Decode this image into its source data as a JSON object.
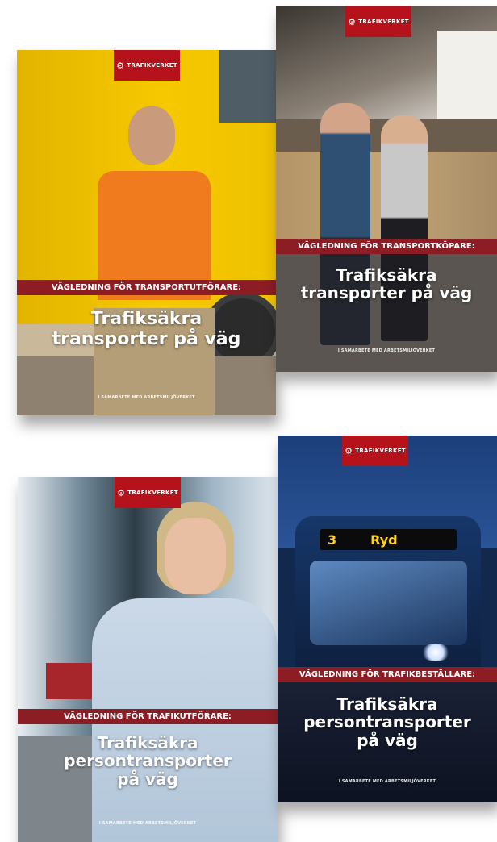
{
  "brand": {
    "name": "TRAFIKVERKET",
    "color": "#b5121b",
    "band_color": "#8c1d24"
  },
  "covers": [
    {
      "guide": "VÄGLEDNING FÖR TRANSPORTUTFÖRARE:",
      "title_lines": [
        "Trafiksäkra",
        "transporter på väg"
      ],
      "coop": "I SAMARBETE MED ARBETSMILJÖVERKET"
    },
    {
      "guide": "VÄGLEDNING FÖR TRANSPORTKÖPARE:",
      "title_lines": [
        "Trafiksäkra",
        "transporter på väg"
      ],
      "coop": "I SAMARBETE MED ARBETSMILJÖVERKET"
    },
    {
      "guide": "VÄGLEDNING FÖR TRAFIKUTFÖRARE:",
      "title_lines": [
        "Trafiksäkra",
        "persontransporter",
        "på väg"
      ],
      "coop": "I SAMARBETE MED ARBETSMILJÖVERKET"
    },
    {
      "guide": "VÄGLEDNING FÖR TRAFIKBESTÄLLARE:",
      "title_lines": [
        "Trafiksäkra",
        "persontransporter",
        "på väg"
      ],
      "coop": "I SAMARBETE MED ARBETSMILJÖVERKET",
      "bus_sign": {
        "number": "3",
        "destination": "Ryd"
      }
    }
  ]
}
